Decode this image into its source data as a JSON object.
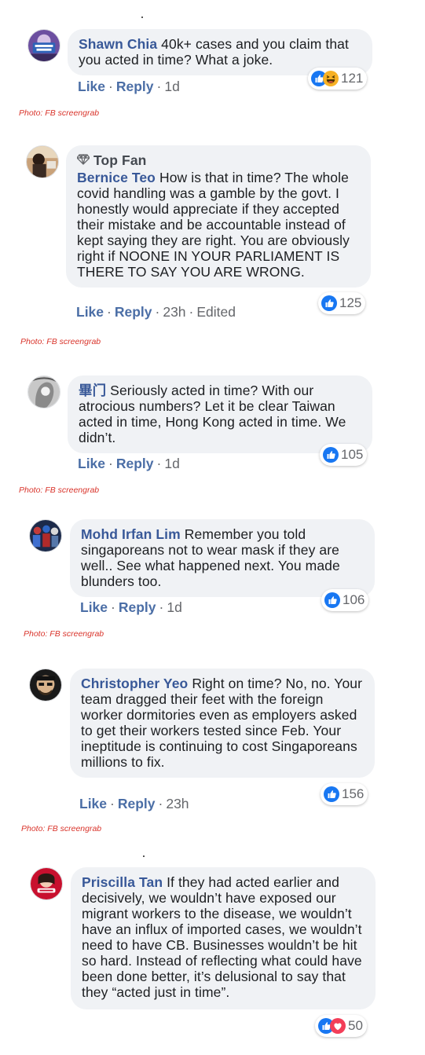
{
  "actions": {
    "like": "Like",
    "reply": "Reply",
    "separator": "·"
  },
  "credit_text": "Photo: FB screengrab",
  "top_fan_label": "Top Fan",
  "colors": {
    "name": "#385898",
    "credit": "#d9342b",
    "like_blue": "#1877f2",
    "love_red": "#f33e58",
    "haha_yellow": "#f7b125"
  },
  "comments": [
    {
      "name": "Shawn Chia",
      "text": "40k+ cases and you claim that you acted in time? What a joke.",
      "time": "1d",
      "reaction_count": "121",
      "reactions": [
        "like-icon",
        "haha-icon"
      ],
      "credit": "Photo: FB screengrab"
    },
    {
      "badge": "Top Fan",
      "name": "Bernice Teo",
      "text": "How is that in time? The whole covid handling was a gamble by the govt. I honestly would appreciate if they accepted their mistake and be accountable instead of kept saying they are right. You are obviously right if NOONE IN YOUR PARLIAMENT IS THERE TO SAY YOU ARE WRONG.",
      "time": "23h",
      "edited": "Edited",
      "reaction_count": "125",
      "reactions": [
        "like-icon"
      ],
      "credit": "Photo: FB screengrab"
    },
    {
      "name": "畢门",
      "text": "Seriously acted in time? With our atrocious numbers? Let it be clear Taiwan acted in time, Hong Kong acted in time. We didn’t.",
      "time": "1d",
      "reaction_count": "105",
      "reactions": [
        "like-icon"
      ],
      "credit": "Photo: FB screengrab"
    },
    {
      "name": "Mohd Irfan Lim",
      "text": "Remember you told singaporeans not to wear mask if they are well.. See what happened next. You made blunders too.",
      "time": "1d",
      "reaction_count": "106",
      "reactions": [
        "like-icon"
      ],
      "credit": "Photo: FB screengrab"
    },
    {
      "name": "Christopher Yeo",
      "text": "Right on time? No, no. Your team dragged their feet with the foreign worker dormitories even as employers asked to get their workers tested since Feb. Your ineptitude is continuing to cost Singaporeans millions to fix.",
      "time": "23h",
      "reaction_count": "156",
      "reactions": [
        "like-icon"
      ],
      "credit": "Photo: FB screengrab"
    },
    {
      "name": "Priscilla Tan",
      "text": "If they had acted earlier and decisively, we wouldn’t have exposed our migrant workers to the disease, we wouldn’t have an influx of imported cases, we wouldn’t need to have CB. Businesses wouldn’t be hit so hard. Instead of reflecting what could have been done better, it’s delusional to say that they “acted just in time”.",
      "reaction_count": "50",
      "reactions": [
        "like-icon",
        "love-icon"
      ]
    }
  ]
}
